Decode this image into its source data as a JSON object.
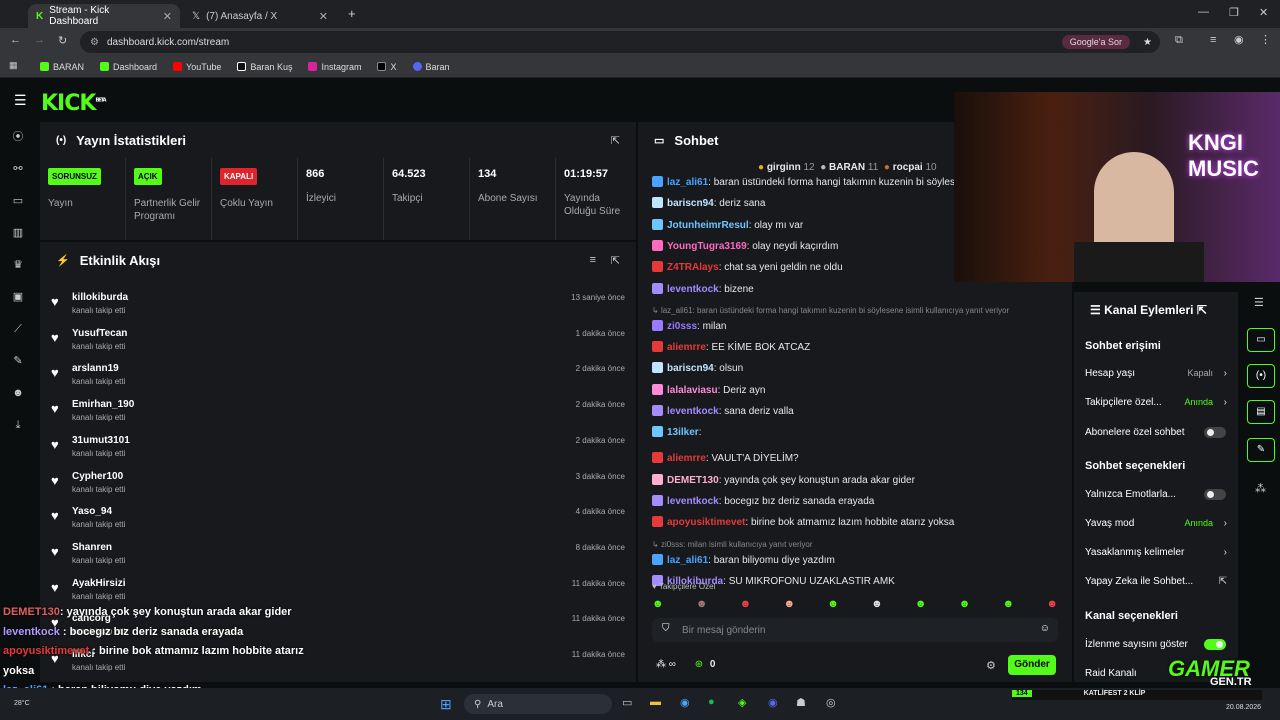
{
  "browser": {
    "tabs": [
      {
        "title": "Stream - Kick Dashboard",
        "active": true
      },
      {
        "title": "(7) Anasayfa / X",
        "active": false
      }
    ],
    "url": "dashboard.kick.com/stream",
    "google_btn": "Google'a Sor",
    "bookmarks": [
      "BARAN",
      "Dashboard",
      "YouTube",
      "Baran Kuş",
      "Instagram",
      "X",
      "Baran"
    ]
  },
  "kick": {
    "logo": "KICK",
    "logo_sup": "BETA"
  },
  "stats": {
    "title": "Yayın İstatistikleri",
    "items": [
      {
        "badge": "SORUNSUZ",
        "badge_color": "#53fc18",
        "label": "Yayın"
      },
      {
        "badge": "AÇIK",
        "badge_color": "#53fc18",
        "label": "Partnerlik Gelir Programı"
      },
      {
        "badge": "KAPALI",
        "badge_color": "#e0242c",
        "label": "Çoklu Yayın"
      },
      {
        "value": "866",
        "label": "İzleyici"
      },
      {
        "value": "64.523",
        "label": "Takipçi"
      },
      {
        "value": "134",
        "label": "Abone Sayısı"
      },
      {
        "value": "01:19:57",
        "label": "Yayında Olduğu Süre"
      }
    ]
  },
  "activity": {
    "title": "Etkinlik Akışı",
    "sub": "kanalı takip etti",
    "items": [
      {
        "name": "killokiburda",
        "time": "13 saniye önce"
      },
      {
        "name": "YusufTecan",
        "time": "1 dakika önce"
      },
      {
        "name": "arslann19",
        "time": "2 dakika önce"
      },
      {
        "name": "Emirhan_190",
        "time": "2 dakika önce"
      },
      {
        "name": "31umut3101",
        "time": "2 dakika önce"
      },
      {
        "name": "Cypher100",
        "time": "3 dakika önce"
      },
      {
        "name": "Yaso_94",
        "time": "4 dakika önce"
      },
      {
        "name": "Shanren",
        "time": "8 dakika önce"
      },
      {
        "name": "AyakHirsizi",
        "time": "11 dakika önce"
      },
      {
        "name": "cancorg",
        "time": "11 dakika önce"
      },
      {
        "name": "ilikci",
        "time": "11 dakika önce"
      }
    ]
  },
  "chat": {
    "title": "Sohbet",
    "top_gifters": [
      {
        "name": "girginn",
        "count": "12"
      },
      {
        "name": "BARAN",
        "count": "11"
      },
      {
        "name": "rocpai",
        "count": "10"
      }
    ],
    "messages": [
      {
        "user": "laz_ali61",
        "color": "#4aa3ff",
        "text": "baran üstündeki forma hangi takımın kuzenin bi söyles"
      },
      {
        "user": "bariscn94",
        "color": "#c3e4ff",
        "text": "deriz sana"
      },
      {
        "user": "JotunheimrResul",
        "color": "#6ec6ff",
        "text": "olay mı var"
      },
      {
        "user": "YoungTugra3169",
        "color": "#ff6ac1",
        "text": "olay neydi kaçırdım"
      },
      {
        "user": "Z4TRAlays",
        "color": "#e63a3a",
        "text": "chat sa yeni geldin ne oldu"
      },
      {
        "user": "leventkock",
        "color": "#a48bff",
        "text": "bizene"
      },
      {
        "reply": "laz_ali61: baran üstündeki forma hangi takımın kuzenin bi söylesene isimli kullanıcıya yanıt veriyor"
      },
      {
        "user": "zi0sss",
        "color": "#9a7bff",
        "text": "milan"
      },
      {
        "user": "aliemrre",
        "color": "#e63a3a",
        "text": "EE KİME BOK ATCAZ"
      },
      {
        "user": "bariscn94",
        "color": "#c3e4ff",
        "text": "olsun"
      },
      {
        "user": "lalalaviasu",
        "color": "#ff8ad8",
        "text": "Deriz ayn"
      },
      {
        "user": "leventkock",
        "color": "#a48bff",
        "text": "sana deriz valla"
      },
      {
        "user": "13ilker",
        "color": "#6ec6ff",
        "text": ""
      },
      {
        "user": "aliemrre",
        "color": "#e63a3a",
        "text": "VAULT'A DİYELİM?"
      },
      {
        "user": "DEMET130",
        "color": "#ffb0d0",
        "text": "yayında çok şey konuştun arada akar gider"
      },
      {
        "user": "leventkock",
        "color": "#a48bff",
        "text": "bocegız bız deriz sanada erayada"
      },
      {
        "user": "apoyusiktimevet",
        "color": "#e63a3a",
        "text": "birine bok atmamız lazım hobbite atarız yoksa"
      },
      {
        "reply": "zi0sss: milan isimli kullanıcıya yanıt veriyor"
      },
      {
        "user": "laz_ali61",
        "color": "#4aa3ff",
        "text": "baran biliyomu diye yazdım"
      },
      {
        "user": "killokiburda",
        "color": "#a48bff",
        "text": "SU MIKROFONU UZAKLASTIR AMK"
      }
    ],
    "followers_only": "Takipçilere Özel",
    "input_placeholder": "Bir mesaj gönderin",
    "points": "0",
    "send": "Gönder"
  },
  "channel": {
    "title": "Kanal Eylemleri",
    "s1": "Sohbet erişimi",
    "rows1": [
      {
        "label": "Hesap yaşı",
        "value": "Kapalı",
        "value_color": "#aaa"
      },
      {
        "label": "Takipçilere özel...",
        "value": "Anında",
        "value_color": "#53fc18"
      }
    ],
    "subs_only": "Abonelere özel sohbet",
    "s2": "Sohbet seçenekleri",
    "emotes_only": "Yalnızca Emotlarla...",
    "slow_mode": "Yavaş mod",
    "slow_val": "Anında",
    "banned_words": "Yasaklanmış kelimeler",
    "ai": "Yapay Zeka ile Sohbet...",
    "s3": "Kanal seçenekleri",
    "show_views": "İzlenme sayısını göster",
    "raid": "Raid Kanalı"
  },
  "overlay": {
    "lines": [
      {
        "user": "DEMET130",
        "color": "#e06060",
        "text": ": yayında çok şey konuştun arada akar gider"
      },
      {
        "user": "leventkock",
        "color": "#b09aff",
        "text": " : bocegız bız deriz sanada erayada"
      },
      {
        "user": "apoyusiktimevet",
        "color": "#e63a3a",
        "text": " : birine bok atmamız lazım hobbite atarız"
      },
      {
        "user": "",
        "color": "#fff",
        "text": "yoksa"
      },
      {
        "user": "laz_ali61",
        "color": "#4aa3ff",
        "text": " : baran biliyomu diye yazdım"
      },
      {
        "user": "killokiburda",
        "color": "#b09aff",
        "text": " : SU MIKROFONU UZAKLASTIR AMK"
      }
    ]
  },
  "webcam": {
    "neon": "KNGI MUSIC"
  },
  "ticker": {
    "count": "134",
    "text": "KATLİFEST 2 KLİP",
    "gamer": "GAMER",
    "gamer_sub": "GEN.TR"
  },
  "taskbar": {
    "search": "Ara",
    "temp": "28°C",
    "date": "20.08.2026"
  }
}
